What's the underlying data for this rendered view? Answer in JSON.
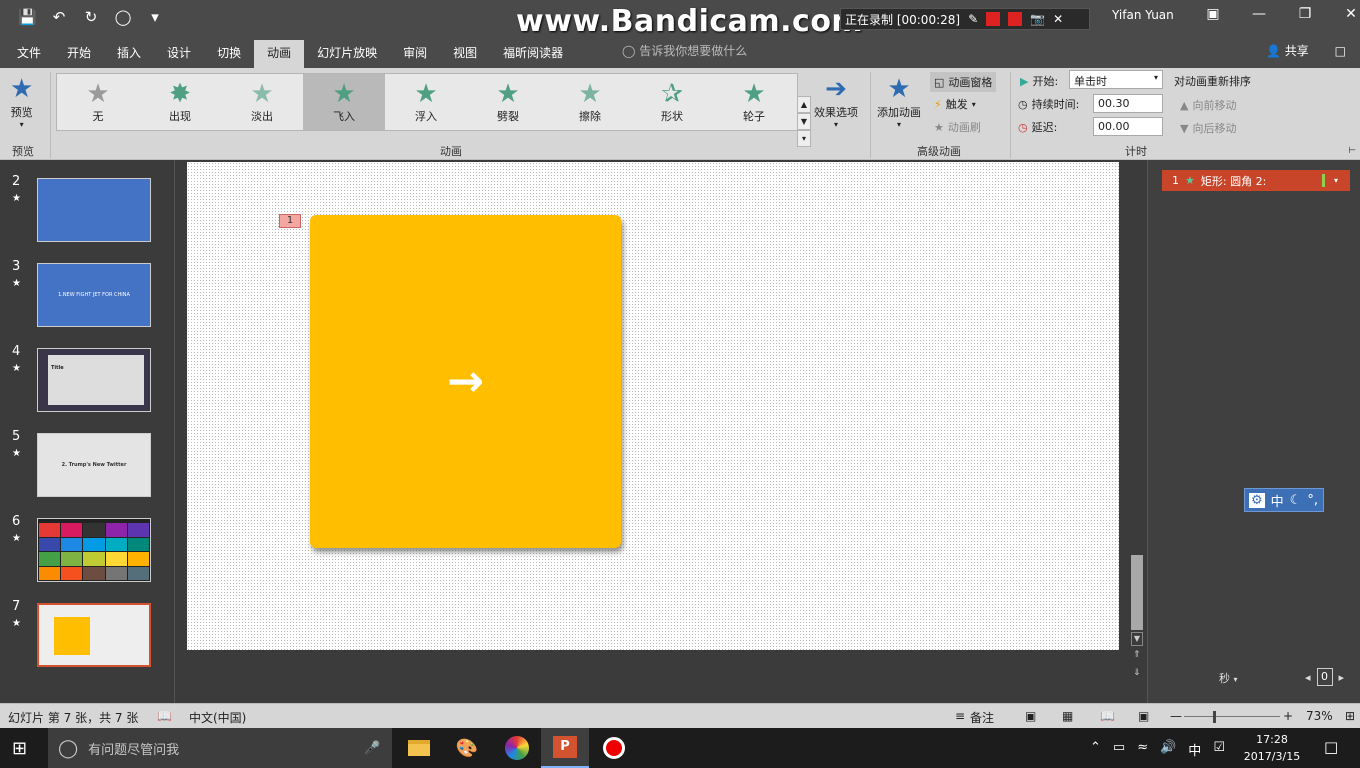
{
  "titlebar": {
    "watermark": "www.Bandicam.com",
    "recording_text": "正在录制 [00:00:28]",
    "user": "Yifan Yuan"
  },
  "tabs": [
    {
      "label": "文件"
    },
    {
      "label": "开始"
    },
    {
      "label": "插入"
    },
    {
      "label": "设计"
    },
    {
      "label": "切换"
    },
    {
      "label": "动画"
    },
    {
      "label": "幻灯片放映"
    },
    {
      "label": "审阅"
    },
    {
      "label": "视图"
    },
    {
      "label": "福昕阅读器"
    }
  ],
  "active_tab": "动画",
  "tellme": "告诉我你想要做什么",
  "share": "共享",
  "ribbon": {
    "preview_label": "预览",
    "preview_group": "预览",
    "animations": [
      {
        "label": "无"
      },
      {
        "label": "出现"
      },
      {
        "label": "淡出"
      },
      {
        "label": "飞入"
      },
      {
        "label": "浮入"
      },
      {
        "label": "劈裂"
      },
      {
        "label": "擦除"
      },
      {
        "label": "形状"
      },
      {
        "label": "轮子"
      }
    ],
    "effect_options": "效果选项",
    "animation_group": "动画",
    "add_animation": "添加动画",
    "animation_pane": "动画窗格",
    "trigger": "触发",
    "animation_painter": "动画刷",
    "advanced_group": "高级动画",
    "start_label": "开始:",
    "start_value": "单击时",
    "duration_label": "持续时间:",
    "duration_value": "00.30",
    "delay_label": "延迟:",
    "delay_value": "00.00",
    "timing_group": "计时",
    "reorder_title": "对动画重新排序",
    "move_earlier": "向前移动",
    "move_later": "向后移动"
  },
  "slides": [
    {
      "num": "2",
      "star": "★"
    },
    {
      "num": "3",
      "star": "★",
      "text": "1.NEW FIGHT JET FOR CHINA"
    },
    {
      "num": "4",
      "star": "★",
      "text": "Title"
    },
    {
      "num": "5",
      "star": "★",
      "text": "2. Trump's New Twitter"
    },
    {
      "num": "6",
      "star": "★"
    },
    {
      "num": "7",
      "star": "★"
    }
  ],
  "canvas": {
    "anim_tag": "1",
    "arrow": "→"
  },
  "anim_pane": {
    "item_num": "1",
    "item_label": "矩形: 圆角 2:",
    "seconds": "秒",
    "zoom_value": "0"
  },
  "ime": {
    "lang": "中"
  },
  "status": {
    "slide_info": "幻灯片 第 7 张，共 7 张",
    "language": "中文(中国)",
    "notes": "备注",
    "zoom": "73%"
  },
  "taskbar": {
    "search_placeholder": "有问题尽管问我",
    "ime": "中",
    "time": "17:28",
    "date": "2017/3/15"
  },
  "colors": {
    "shape": "#ffbf00",
    "anim_item": "#c8452a",
    "accent": "#2e6bb0"
  }
}
